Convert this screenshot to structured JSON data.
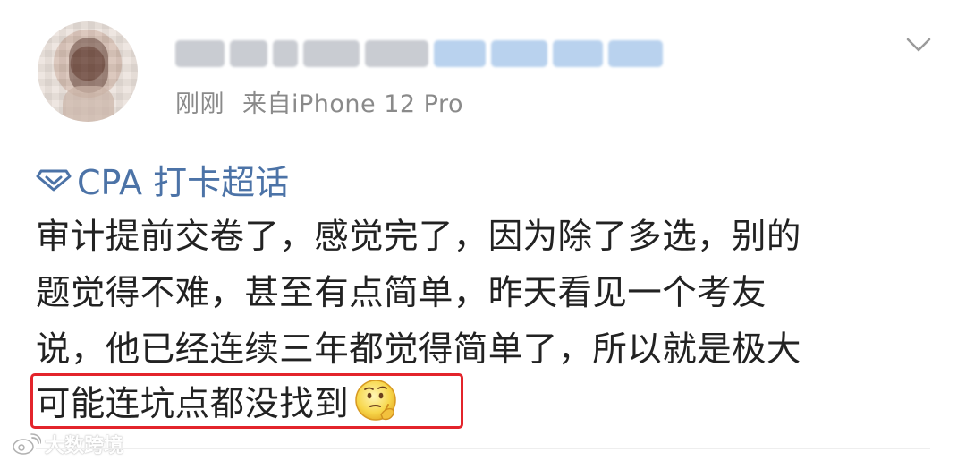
{
  "post": {
    "meta": {
      "time": "刚刚",
      "source": "来自iPhone 12 Pro"
    },
    "topic": {
      "label": "CPA 打卡超话"
    },
    "content": {
      "lines": [
        "审计提前交卷了，感觉完了，因为除了多选，别的",
        "题觉得不难，甚至有点简单，昨天看见一个考友",
        "说，他已经连续三年都觉得简单了，所以就是极大",
        "可能连坑点都没找到"
      ]
    },
    "emoji_icon": "thinking-face-emoji",
    "expand_icon": "chevron-down-icon",
    "topic_icon": "diamond-icon"
  },
  "watermark": {
    "text": "大数跨境"
  },
  "colors": {
    "topic_blue": "#4c73a7",
    "meta_gray": "#8a8a8a",
    "highlight_red": "#e3242b",
    "text": "#222222"
  }
}
